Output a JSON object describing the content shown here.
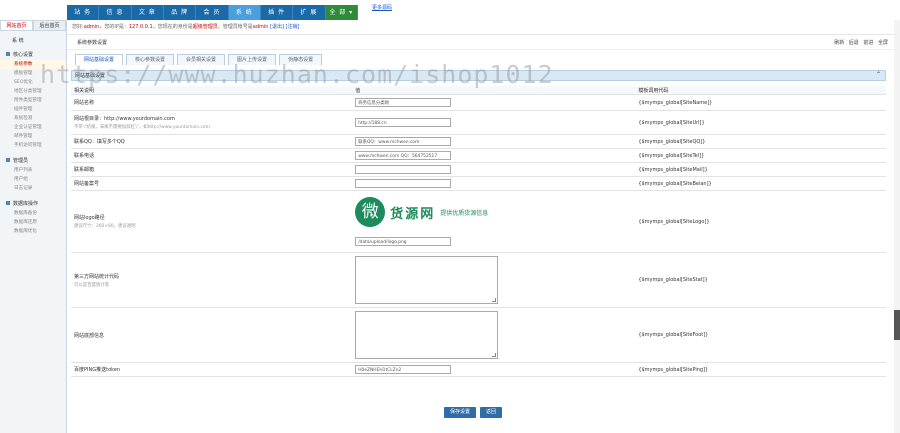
{
  "topnav": {
    "tabs": [
      {
        "label": "站 务"
      },
      {
        "label": "信 息"
      },
      {
        "label": "文 章"
      },
      {
        "label": "品 牌"
      },
      {
        "label": "会 员"
      },
      {
        "label": "系 统"
      },
      {
        "label": "插 件"
      },
      {
        "label": "扩 展"
      },
      {
        "label": "全 部 ▾"
      }
    ],
    "more_link": "更多源码"
  },
  "left": {
    "tabs": [
      "网站首页",
      "后台首页"
    ],
    "title": "系 统",
    "groups": [
      {
        "title": "核心设置",
        "items": [
          "系统参数",
          "模板管理",
          "SEO优化",
          "地区分类管理",
          "附件类型管理",
          "插件管理",
          "系统检测",
          "企业认证管理",
          "邮件管理",
          "手机访问管理"
        ]
      },
      {
        "title": "管理员",
        "items": [
          "用户列表",
          "用户组",
          "日志记录"
        ]
      },
      {
        "title": "数据库操作",
        "items": [
          "数据库备份",
          "数据库还原",
          "数据库优化"
        ]
      }
    ]
  },
  "subbar": {
    "prefix": "您好:",
    "user": "admin",
    "mid": "，您的IP是：",
    "ip": "127.0.0.1",
    "msg1": "，您现在的身份是",
    "role": "超级管理员",
    "msg2": "，管理员帐号是",
    "account": "admin",
    "links": "[退出] [注销]"
  },
  "page": {
    "title": "系统参数设置",
    "tools": "刷新 后退 前进 全屏"
  },
  "tabs": [
    "网站基础设置",
    "核心参数设置",
    "会员相关设置",
    "图片上传设置",
    "伪静态设置"
  ],
  "section_header": "网站基础设置",
  "table": {
    "columns": [
      "相关说明",
      "值",
      "模板调用代码"
    ],
    "rows": [
      {
        "label": "网站名称",
        "hint": "",
        "value": "商务信息分类网",
        "code": "{$mymps_global[SiteName]}"
      },
      {
        "label": "网站根目录：http://www.yourdomain.com",
        "hint": "不带'/'结尾，末尾不需要加斜杠'/'，如http://www.yourdomain.com",
        "value": "http://188.cn",
        "code": "{$mymps_global[SiteUrl]}"
      },
      {
        "label": "联系QQ：填写多个QQ",
        "hint": "",
        "value": "联系QQ：www.mchwen.com",
        "code": "{$mymps_global[SiteQQ]}"
      },
      {
        "label": "联系电话",
        "hint": "",
        "value": "www.mchwen.com QQ：564752517",
        "code": "{$mymps_global[SiteTel]}"
      },
      {
        "label": "联系邮箱",
        "hint": "",
        "value": "",
        "code": "{$mymps_global[SiteMail]}"
      },
      {
        "label": "网站备案号",
        "hint": "",
        "value": "",
        "code": "{$mymps_global[SiteBeian]}"
      },
      {
        "label": "网站logo路径",
        "hint": "建议尺寸：260×80，建议透明",
        "value": "/data/upload/logo.png",
        "code": "{$mymps_global[SiteLogo]}"
      },
      {
        "label": "第三方网站统计代码",
        "hint": "可以是百度统计等",
        "value": "",
        "code": "{$mymps_global[SiteStat]}"
      },
      {
        "label": "网站底部信息",
        "hint": "",
        "value": "",
        "code": "{$mymps_global[SiteFoot]}"
      },
      {
        "label": "百度PING推送token",
        "hint": "",
        "value": "H0eZNHEH1tCLZn2",
        "code": "{$mymps_global[SitePing]}"
      }
    ]
  },
  "logo": {
    "seal": "微",
    "name": "货源网",
    "tagline": "提供优质货源信息"
  },
  "buttons": {
    "save": "保存设置",
    "back": "返回"
  },
  "watermark": "https://www.huzhan.com/ishop1012"
}
